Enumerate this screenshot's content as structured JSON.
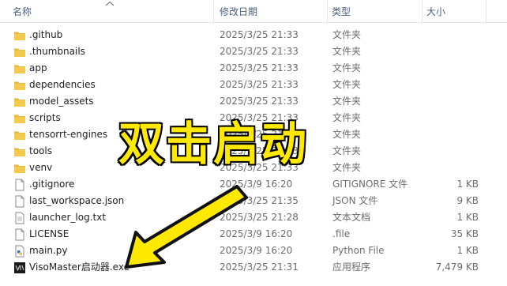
{
  "columns": {
    "name": "名称",
    "date": "修改日期",
    "type": "类型",
    "size": "大小"
  },
  "files": [
    {
      "name": ".github",
      "date": "2025/3/25 21:33",
      "type": "文件夹",
      "size": "",
      "icon": "folder-icon"
    },
    {
      "name": ".thumbnails",
      "date": "2025/3/25 21:33",
      "type": "文件夹",
      "size": "",
      "icon": "folder-icon"
    },
    {
      "name": "app",
      "date": "2025/3/25 21:33",
      "type": "文件夹",
      "size": "",
      "icon": "folder-icon"
    },
    {
      "name": "dependencies",
      "date": "2025/3/25 21:33",
      "type": "文件夹",
      "size": "",
      "icon": "folder-icon"
    },
    {
      "name": "model_assets",
      "date": "2025/3/25 21:33",
      "type": "文件夹",
      "size": "",
      "icon": "folder-icon"
    },
    {
      "name": "scripts",
      "date": "2025/3/25 21:33",
      "type": "文件夹",
      "size": "",
      "icon": "folder-icon"
    },
    {
      "name": "tensorrt-engines",
      "date": "2025/3/25 21:33",
      "type": "文件夹",
      "size": "",
      "icon": "folder-icon"
    },
    {
      "name": "tools",
      "date": "2025/3/25 21:33",
      "type": "文件夹",
      "size": "",
      "icon": "folder-icon"
    },
    {
      "name": "venv",
      "date": "2025/3/25 21:33",
      "type": "文件夹",
      "size": "",
      "icon": "folder-icon"
    },
    {
      "name": ".gitignore",
      "date": "2025/3/9 16:20",
      "type": "GITIGNORE 文件",
      "size": "1 KB",
      "icon": "file-icon"
    },
    {
      "name": "last_workspace.json",
      "date": "2025/3/25 21:35",
      "type": "JSON 文件",
      "size": "9 KB",
      "icon": "file-icon"
    },
    {
      "name": "launcher_log.txt",
      "date": "2025/3/25 21:28",
      "type": "文本文档",
      "size": "1 KB",
      "icon": "text-file-icon"
    },
    {
      "name": "LICENSE",
      "date": "2025/3/9 16:20",
      "type": ".file",
      "size": "35 KB",
      "icon": "file-icon"
    },
    {
      "name": "main.py",
      "date": "2025/3/9 16:20",
      "type": "Python File",
      "size": "1 KB",
      "icon": "python-file-icon"
    },
    {
      "name": "VisoMaster启动器.exe",
      "date": "2025/3/25 21:31",
      "type": "应用程序",
      "size": "7,479 KB",
      "icon": "exe-app-icon"
    }
  ],
  "overlay": {
    "text": "双击启动",
    "text_color": "#ffe900",
    "arrow_color": "#ffe900"
  },
  "colors": {
    "folder": "#f3c94e",
    "header_text": "#4c607a",
    "secondary_text": "#6d6d6d"
  }
}
